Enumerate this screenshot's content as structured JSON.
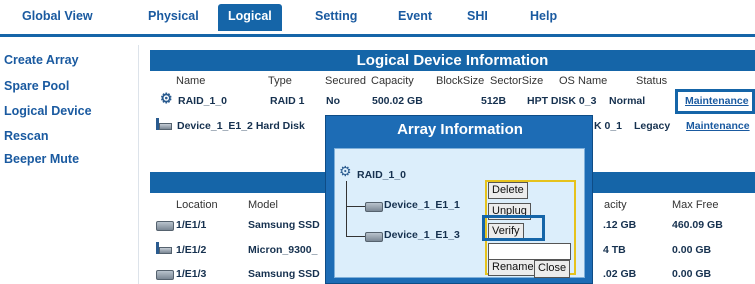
{
  "nav": {
    "items": [
      "Global View",
      "Physical",
      "Logical",
      "Setting",
      "Event",
      "SHI",
      "Help"
    ],
    "active": "Logical"
  },
  "sidebar": {
    "items": [
      "Create Array",
      "Spare Pool",
      "Logical Device",
      "Rescan",
      "Beeper Mute"
    ]
  },
  "logical": {
    "title": "Logical Device Information",
    "headers": [
      "Name",
      "Type",
      "Secured",
      "Capacity",
      "BlockSize",
      "SectorSize",
      "OS Name",
      "Status"
    ],
    "rows": [
      {
        "name": "RAID_1_0",
        "type": "RAID 1",
        "secured": "No",
        "capacity": "500.02 GB",
        "block": "512B",
        "osname": "HPT DISK 0_3",
        "status": "Normal",
        "action": "Maintenance"
      },
      {
        "name": "Device_1_E1_2",
        "type": "Hard Disk",
        "osname": "K 0_1",
        "status": "Legacy",
        "action": "Maintenance"
      }
    ]
  },
  "physical": {
    "headers": [
      "Location",
      "Model",
      "acity",
      "Max Free"
    ],
    "rows": [
      {
        "location": "1/E1/1",
        "model": "Samsung SSD",
        "capacity": ".12 GB",
        "maxfree": "460.09 GB"
      },
      {
        "location": "1/E1/2",
        "model": "Micron_9300_",
        "capacity": "4 TB",
        "maxfree": "0.00 GB"
      },
      {
        "location": "1/E1/3",
        "model": "Samsung SSD",
        "capacity": ".02 GB",
        "maxfree": "0.00 GB"
      }
    ]
  },
  "dialog": {
    "title": "Array Information",
    "tree": {
      "root": "RAID_1_0",
      "children": [
        "Device_1_E1_1",
        "Device_1_E1_3"
      ]
    },
    "menu": [
      "Delete",
      "Unplug",
      "Verify",
      "",
      "Rename"
    ],
    "close": "Close"
  }
}
